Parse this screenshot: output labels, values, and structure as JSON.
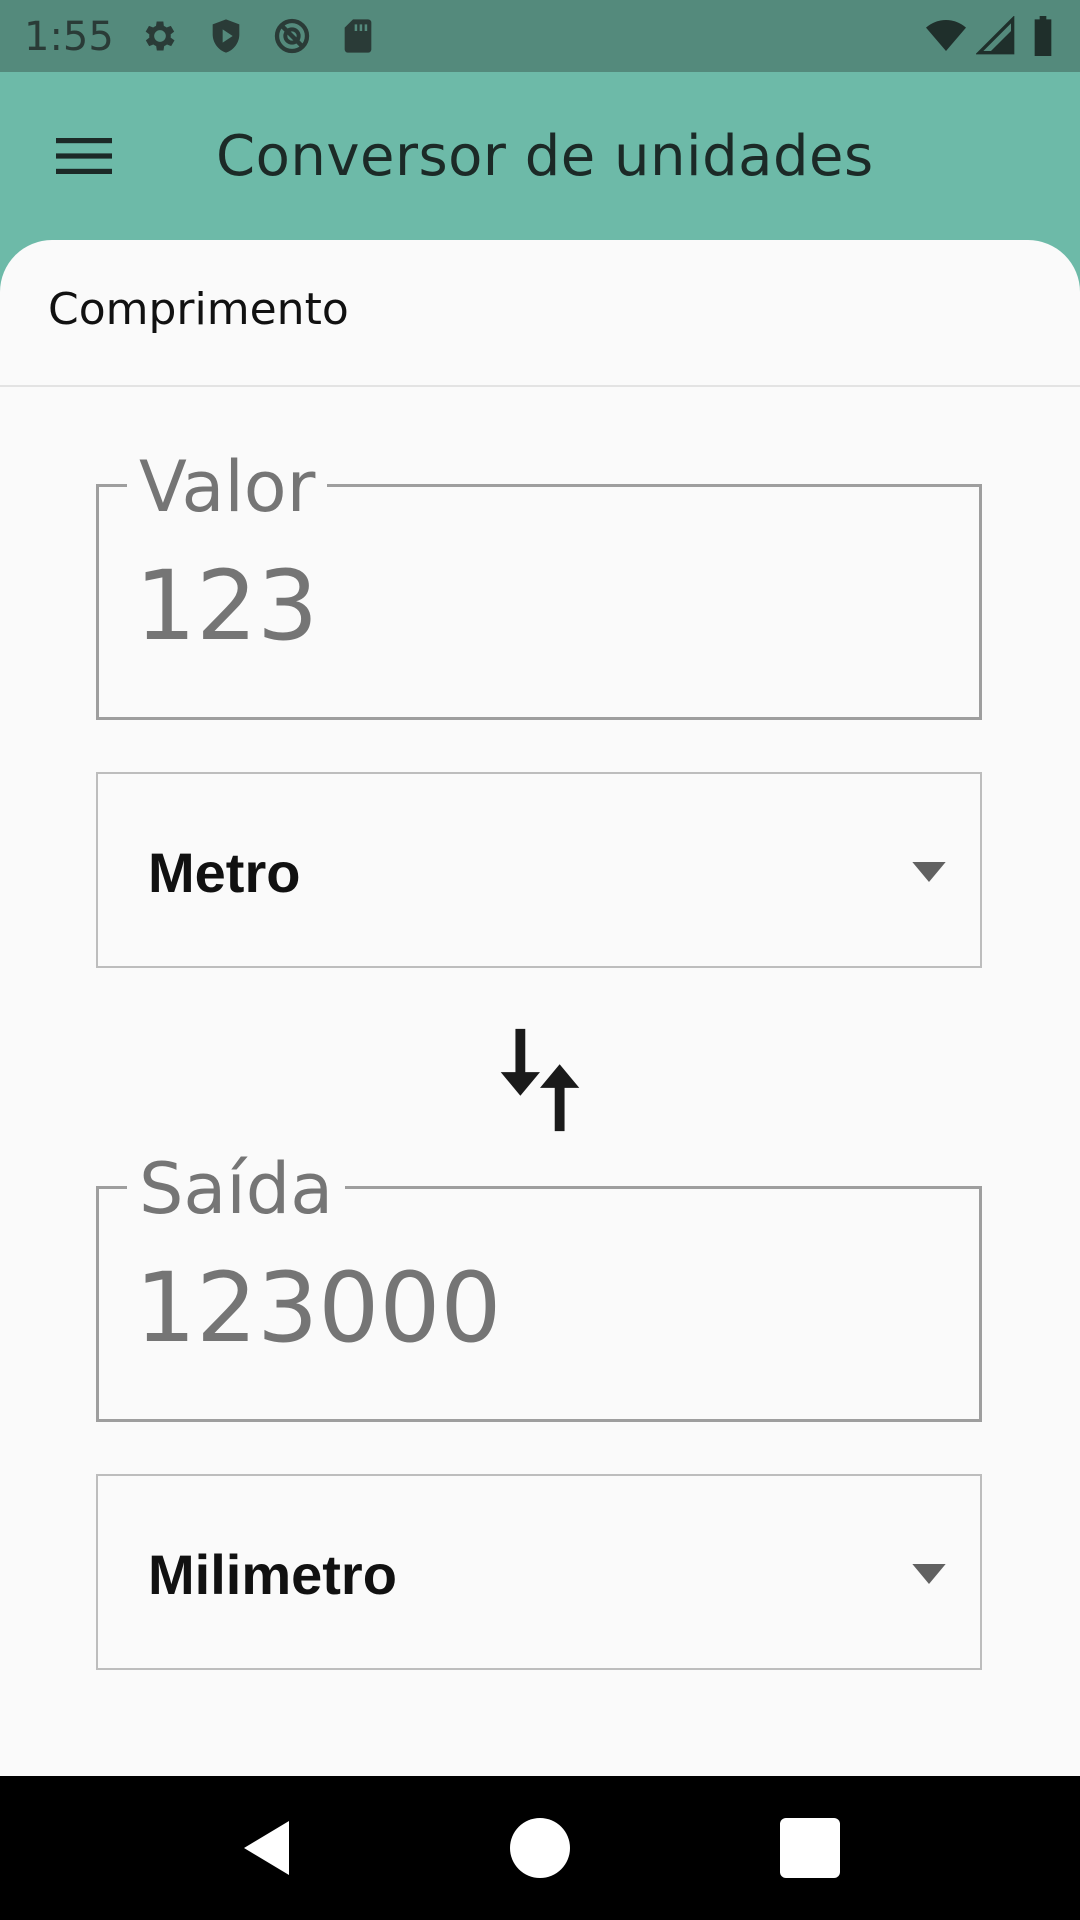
{
  "status_bar": {
    "time": "1:55",
    "left_icons": [
      "gear-icon",
      "shield-play-icon",
      "vpn-blocked-icon",
      "sd-card-icon"
    ],
    "right_icons": [
      "wifi-icon",
      "cellular-signal-icon",
      "battery-icon"
    ]
  },
  "app_bar": {
    "title": "Conversor de unidades",
    "menu_icon": "hamburger-menu-icon"
  },
  "category": {
    "label": "Comprimento"
  },
  "input_field": {
    "label": "Valor",
    "value": "123"
  },
  "from_unit": {
    "selected": "Metro"
  },
  "swap": {
    "icon": "swap-vertical-icon"
  },
  "output_field": {
    "label": "Saída",
    "value": "123000"
  },
  "to_unit": {
    "selected": "Milimetro"
  },
  "nav_bar": {
    "buttons": [
      "back-icon",
      "home-icon",
      "recents-icon"
    ]
  },
  "colors": {
    "app_bar": "#6dbaa8",
    "status_bar": "#548a7c",
    "surface": "#fafafa",
    "nav_bar": "#000000"
  }
}
